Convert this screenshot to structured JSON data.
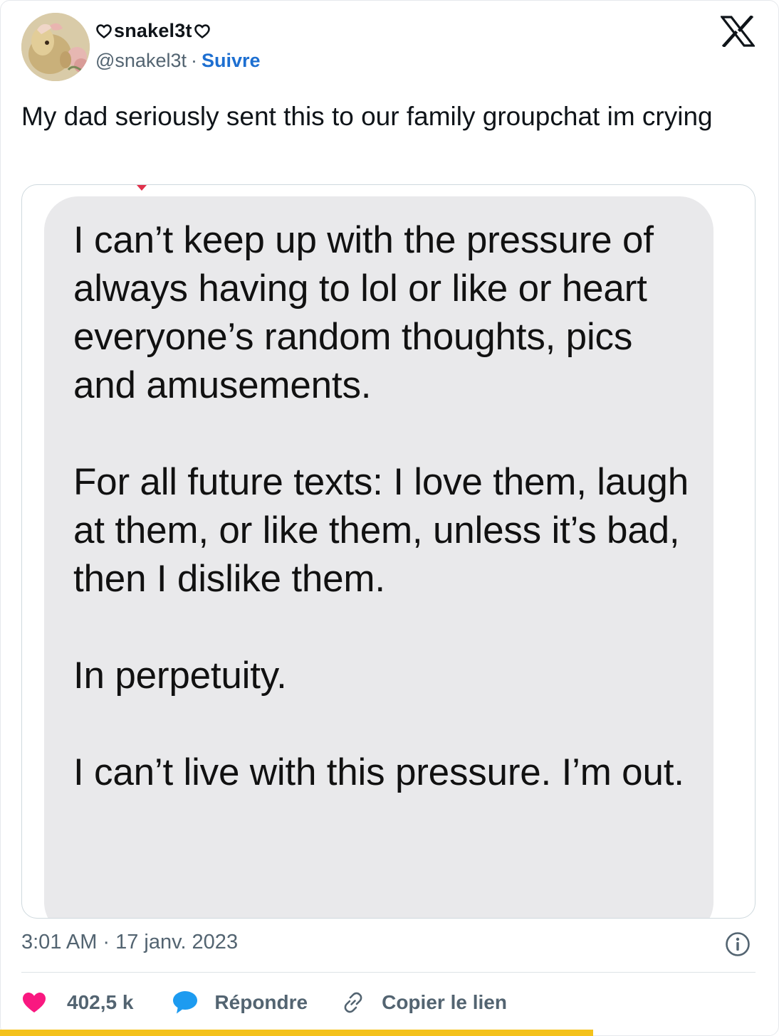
{
  "user": {
    "display_name": "snakel3t",
    "handle": "@snakel3t",
    "separator": "·",
    "follow_label": "Suivre"
  },
  "tweet": {
    "text": "My dad seriously sent this to our family groupchat im crying"
  },
  "media": {
    "message": "I can’t keep up with the pressure of always having to lol or like or heart everyone’s random thoughts, pics and amusements.\n\nFor all future texts: I love them, laugh at them, or like them, unless it’s bad, then I dislike them.\n\nIn perpetuity.\n\nI can’t live with this pressure.  I’m out."
  },
  "meta": {
    "time": "3:01 AM",
    "separator": "·",
    "date": "17 janv. 2023"
  },
  "actions": {
    "like_count": "402,5 k",
    "reply_label": "Répondre",
    "copy_label": "Copier le lien"
  },
  "colors": {
    "like": "#f91880",
    "reply": "#1d9bf0",
    "link": "#1d6fd1",
    "muted": "#536471",
    "bubble": "#e9e9eb",
    "accent_bar": "#f4c21b"
  },
  "icons": {
    "heart_outline": "heart-outline-icon",
    "x_logo": "x-logo-icon",
    "info": "info-icon",
    "like": "heart-icon",
    "reply": "speech-bubble-icon",
    "copy": "link-icon"
  }
}
